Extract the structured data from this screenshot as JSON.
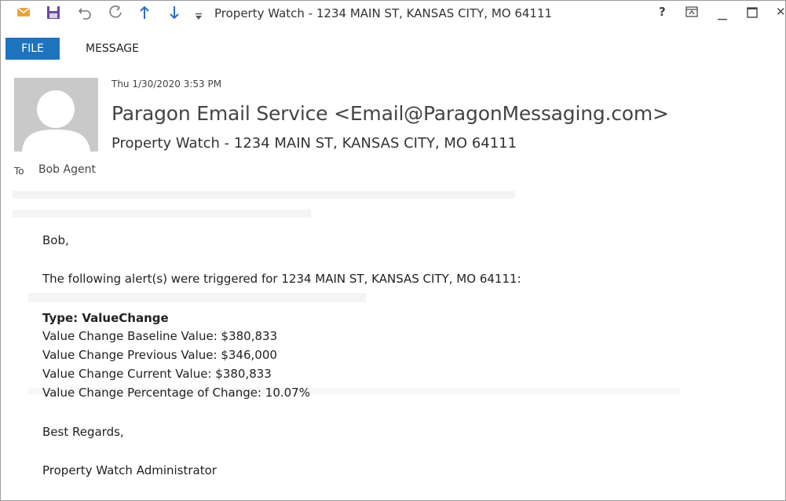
{
  "window": {
    "title": "Property Watch - 1234 MAIN ST, KANSAS CITY, MO 64111",
    "help": "?",
    "close": "✕"
  },
  "ribbon": {
    "file_label": "FILE",
    "message_label": "MESSAGE"
  },
  "email": {
    "date": "Thu 1/30/2020 3:53 PM",
    "sender": "Paragon Email Service <Email@ParagonMessaging.com>",
    "subject": "Property Watch - 1234 MAIN ST, KANSAS CITY, MO 64111",
    "to_label": "To",
    "to_value": "Bob Agent"
  },
  "body": {
    "greeting": "Bob,",
    "intro": "The following alert(s) were triggered for 1234 MAIN ST, KANSAS CITY, MO 64111:",
    "type_line": "Type: ValueChange",
    "baseline": "Value Change Baseline Value: $380,833",
    "previous": "Value Change Previous Value: $346,000",
    "current": "Value Change Current Value: $380,833",
    "percentage": "Value Change Percentage of Change: 10.07%",
    "regards": "Best Regards,",
    "signature": "Property Watch Administrator"
  },
  "colors": {
    "file_tab": "#1e73be",
    "qa_mail": "#e6a53a",
    "qa_save": "#6a4a9c",
    "qa_arrows": "#2b6cc4"
  }
}
